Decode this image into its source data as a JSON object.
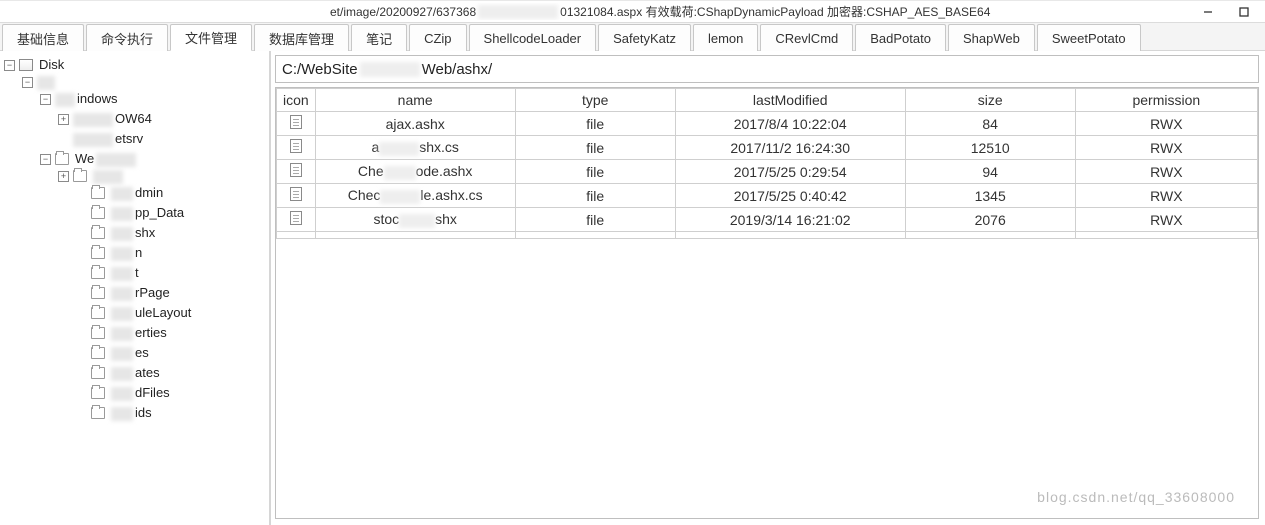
{
  "title": {
    "url_prefix": "et/image/20200927/637368",
    "url_suffix": "01321084.aspx",
    "payload_label": "有效载荷:CShapDynamicPayload",
    "encryptor_label": "加密器:CSHAP_AES_BASE64"
  },
  "tabs": [
    {
      "label": "基础信息",
      "active": false
    },
    {
      "label": "命令执行",
      "active": false
    },
    {
      "label": "文件管理",
      "active": true
    },
    {
      "label": "数据库管理",
      "active": false
    },
    {
      "label": "笔记",
      "active": false
    },
    {
      "label": "CZip",
      "active": false
    },
    {
      "label": "ShellcodeLoader",
      "active": false
    },
    {
      "label": "SafetyKatz",
      "active": false
    },
    {
      "label": "lemon",
      "active": false
    },
    {
      "label": "CRevlCmd",
      "active": false
    },
    {
      "label": "BadPotato",
      "active": false
    },
    {
      "label": "ShapWeb",
      "active": false
    },
    {
      "label": "SweetPotato",
      "active": false
    }
  ],
  "tree": {
    "root": "Disk",
    "c_suffix": "indows",
    "w64": "OW64",
    "etsrv": "etsrv",
    "we": "We",
    "items": [
      "dmin",
      "pp_Data",
      "shx",
      "n",
      "t",
      "rPage",
      "uleLayout",
      "erties",
      "es",
      "ates",
      "dFiles",
      "ids"
    ],
    "items_prefix": [
      "A",
      "A",
      "a",
      "",
      "",
      "E",
      "Mod",
      "",
      "Prop",
      "S",
      "Templ",
      "Upload",
      "Upl"
    ]
  },
  "path": {
    "prefix": "C:/WebSite",
    "suffix": "Web/ashx/"
  },
  "columns": [
    "icon",
    "name",
    "type",
    "lastModified",
    "size",
    "permission"
  ],
  "rows": [
    {
      "name": "ajax.ashx",
      "blur_w": 0,
      "suffix": "",
      "type": "file",
      "lastModified": "2017/8/4 10:22:04",
      "size": "84",
      "permission": "RWX"
    },
    {
      "name": "a",
      "blur_w": 40,
      "suffix": "shx.cs",
      "type": "file",
      "lastModified": "2017/11/2 16:24:30",
      "size": "12510",
      "permission": "RWX"
    },
    {
      "name": "Che",
      "blur_w": 32,
      "suffix": "ode.ashx",
      "type": "file",
      "lastModified": "2017/5/25 0:29:54",
      "size": "94",
      "permission": "RWX"
    },
    {
      "name": "Chec",
      "blur_w": 40,
      "suffix": "le.ashx.cs",
      "type": "file",
      "lastModified": "2017/5/25 0:40:42",
      "size": "1345",
      "permission": "RWX"
    },
    {
      "name": "stoc",
      "blur_w": 36,
      "suffix": "shx",
      "type": "file",
      "lastModified": "2019/3/14 16:21:02",
      "size": "2076",
      "permission": "RWX"
    },
    {
      "name": "",
      "blur_w": 0,
      "suffix": "",
      "type": "",
      "lastModified": "",
      "size": "",
      "permission": ""
    }
  ],
  "watermark": "blog.csdn.net/qq_33608000"
}
